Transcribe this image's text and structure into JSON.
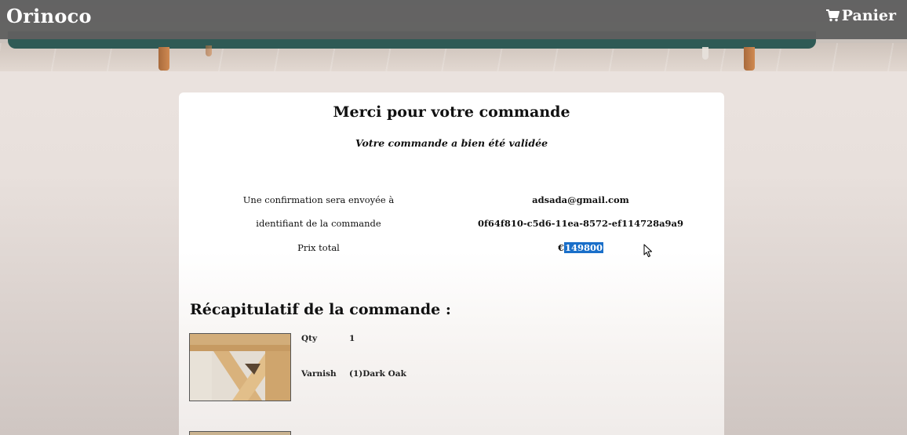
{
  "header": {
    "brand": "Orinoco",
    "cart_label": "Panier",
    "cart_icon": "shopping-cart-icon"
  },
  "confirmation": {
    "title": "Merci pour votre commande",
    "subtitle": "Votre commande a bien été validée",
    "rows": [
      {
        "label": "Une confirmation sera envoyée à",
        "value": "adsada@gmail.com"
      },
      {
        "label": "identifiant de la commande",
        "value": "0f64f810-c5d6-11ea-8572-ef114728a9a9"
      },
      {
        "label": "Prix total",
        "currency": "€",
        "value": "149800"
      }
    ],
    "highlight_color": "#1a6fc9"
  },
  "recap": {
    "title": "Récapitulatif de la commande :",
    "items": [
      {
        "qty_label": "Qty",
        "qty_value": "1",
        "varnish_label": "Varnish",
        "varnish_value": "(1)Dark Oak"
      }
    ]
  }
}
